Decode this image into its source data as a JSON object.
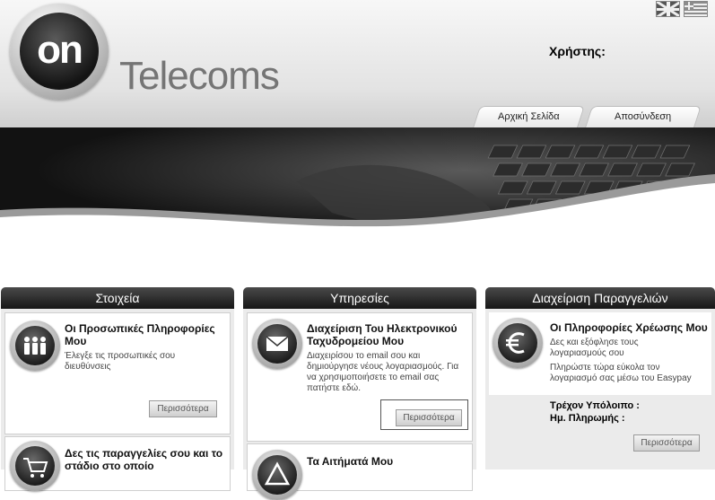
{
  "header": {
    "brand_logo_text": "on",
    "brand_name": "Telecoms",
    "user_label": "Χρήστης:",
    "languages": [
      "English",
      "Ελληνικά"
    ],
    "tabs": [
      {
        "label": "Αρχική Σελίδα"
      },
      {
        "label": "Αποσύνδεση"
      }
    ]
  },
  "colors": {
    "header_top": "#f7f7f7",
    "header_bottom": "#cfcfcf",
    "section_header": "#1f1f1f",
    "panel_bg": "#ebebeb",
    "brand_text": "#757575"
  },
  "sections": [
    {
      "title": "Στοιχεία",
      "cards": [
        {
          "icon": "people-icon",
          "title": "Οι Προσωπικές Πληροφορίες Μου",
          "text": "Έλεγξε τις προσωπικές σου διευθύνσεις",
          "button": "Περισσότερα"
        },
        {
          "icon": "cart-icon",
          "title": "Δες τις παραγγελίες σου και το στάδιο στο οποίο"
        }
      ]
    },
    {
      "title": "Υπηρεσίες",
      "cards": [
        {
          "icon": "envelope-icon",
          "title": "Διαχείριση Του Ηλεκτρονικού Ταχυδρομείου Μου",
          "text": "Διαχειρίσου το email σου και δημιούργησε νέους λογαριασμούς. Για να χρησιμοποιήσετε το email σας πατήστε εδώ.",
          "button": "Περισσότερα"
        },
        {
          "icon": "warning-icon",
          "title": "Τα Αιτήματά Μου"
        }
      ]
    },
    {
      "title": "Διαχείριση Παραγγελιών",
      "cards": [
        {
          "icon": "euro-icon",
          "title": "Οι Πληροφορίες Χρέωσης Μου",
          "text": "Δες και εξόφλησε τους λογαριασμούς σου",
          "text2": "Πληρώστε τώρα εύκολα τον λογαριασμό σας μέσω του Easypay",
          "balance_label": "Τρέχον Υπόλοιπο :",
          "payment_label": "Ημ. Πληρωμής :",
          "button": "Περισσότερα"
        }
      ]
    }
  ]
}
